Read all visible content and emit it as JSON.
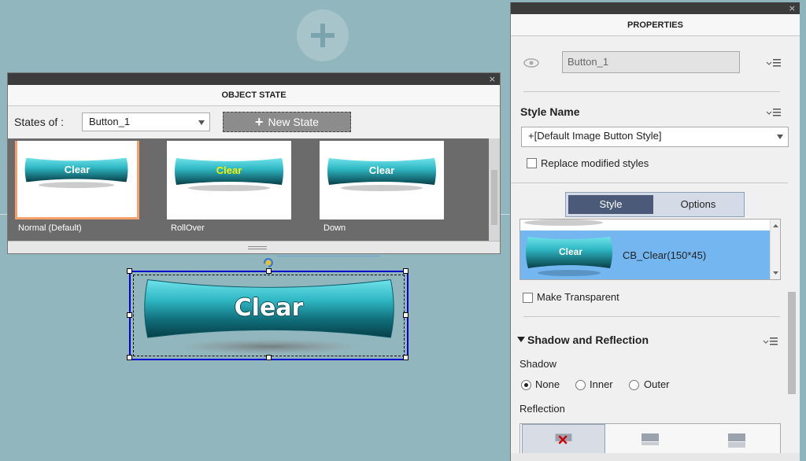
{
  "object_state": {
    "title": "OBJECT STATE",
    "close_glyph": "×",
    "states_of_label": "States of :",
    "selected_object": "Button_1",
    "new_state_label": "New State",
    "states": [
      {
        "label": "Normal (Default)",
        "button_text": "Clear",
        "text_color": "#ffffff"
      },
      {
        "label": "RollOver",
        "button_text": "Clear",
        "text_color": "#f2f200"
      },
      {
        "label": "Down",
        "button_text": "Clear",
        "text_color": "#ffffff"
      }
    ]
  },
  "stage": {
    "button_text": "Clear"
  },
  "properties": {
    "title": "PROPERTIES",
    "close_glyph": "×",
    "object_name": "Button_1",
    "style_name_heading": "Style Name",
    "style_select_value": "+[Default Image Button Style]",
    "replace_modified_label": "Replace modified styles",
    "tabs": {
      "style": "Style",
      "options": "Options"
    },
    "style_item": {
      "thumb_text": "Clear",
      "label": "CB_Clear(150*45)"
    },
    "make_transparent_label": "Make Transparent",
    "shadow_reflection_heading": "Shadow and Reflection",
    "shadow_label": "Shadow",
    "shadow_options": [
      "None",
      "Inner",
      "Outer"
    ],
    "shadow_selected": "None",
    "reflection_label": "Reflection"
  },
  "colors": {
    "accent_blue": "#74b6f0",
    "tab_active": "#4a5a78",
    "selected_state_border": "#f4a06b",
    "button_teal": "#2fb8c4"
  }
}
